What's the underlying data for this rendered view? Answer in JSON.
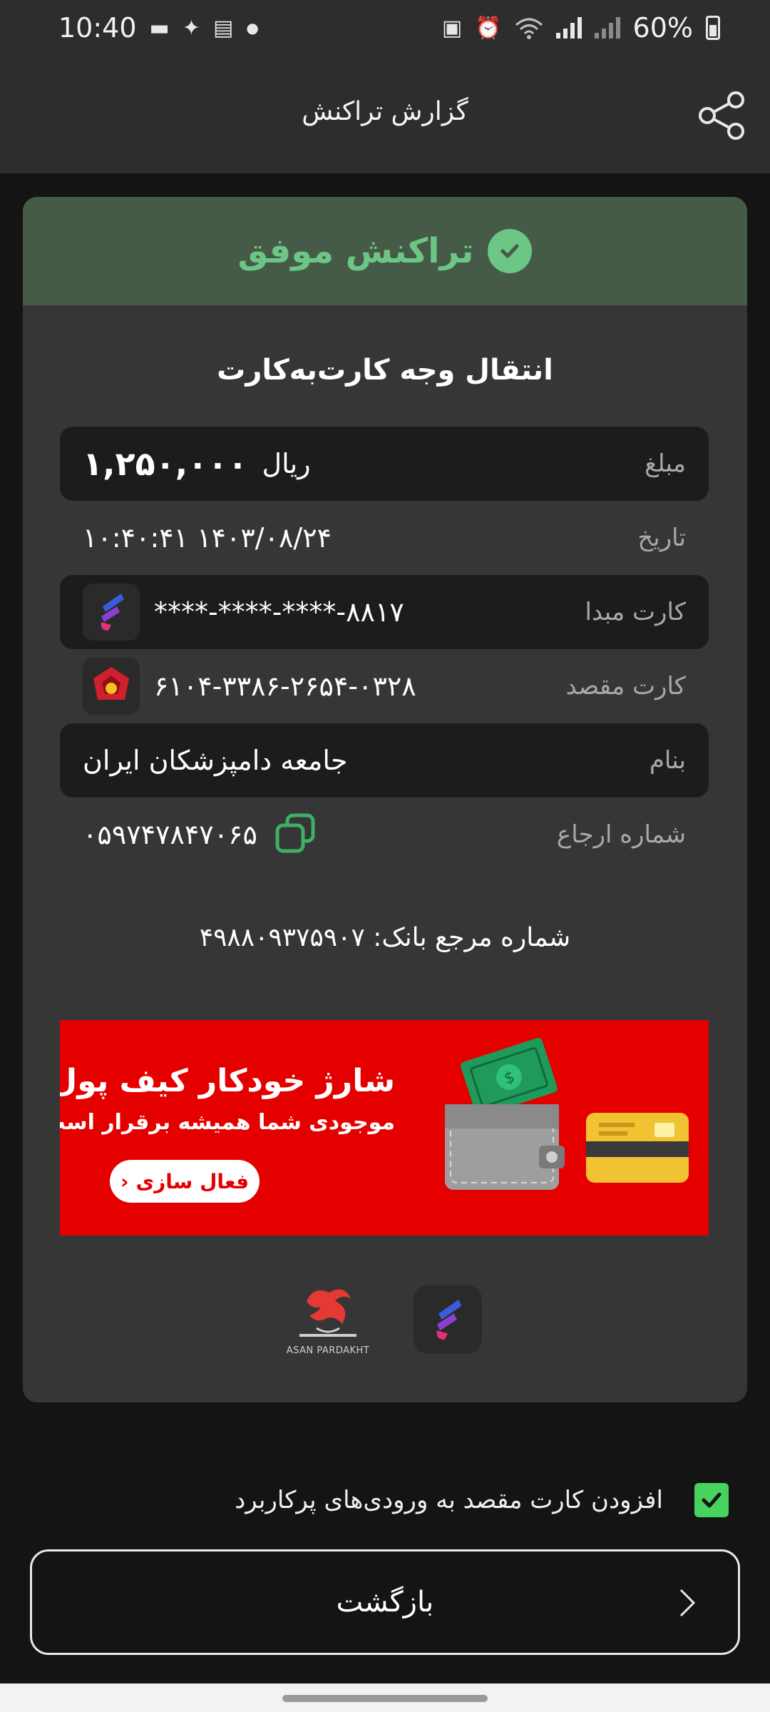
{
  "status_bar": {
    "time": "10:40",
    "battery": "60%",
    "icons": [
      "chat-icon",
      "bird-icon",
      "message-icon",
      "dot-icon",
      "battery-saver-icon",
      "alarm-icon",
      "wifi-icon",
      "signal-icon",
      "signal-icon-2",
      "battery-icon"
    ]
  },
  "header": {
    "title": "گزارش تراکنش",
    "share_icon": "share-icon"
  },
  "receipt": {
    "status": "تراکنش موفق",
    "status_color": "#6cc685",
    "type": "انتقال وجه کارت‌به‌کارت",
    "amount_label": "مبلغ",
    "amount_value": "۱,۲۵۰,۰۰۰",
    "amount_unit": "ریال",
    "date_label": "تاریخ",
    "date_value": "۱۰:۴۰:۴۱ ۱۴۰۳/۰۸/۲۴",
    "source_label": "کارت مبدا",
    "source_value": "****-****-****-۸۸۱۷",
    "dest_label": "کارت مقصد",
    "dest_value": "۶۱۰۴-۳۳۸۶-۲۶۵۴-۰۳۲۸",
    "name_label": "بنام",
    "name_value": "جامعه دامپزشکان ایران",
    "ref_label": "شماره ارجاع",
    "ref_value": "۰۵۹۷۴۷۸۴۷۰۶۵",
    "bank_ref": "شماره مرجع بانک: ۴۹۸۸۰۹۳۷۵۹۰۷"
  },
  "ad": {
    "title": "شارژ خودکار کیف پول",
    "subtitle": "موجودی شما همیشه برقرار است",
    "button": "فعال سازی",
    "bg_color": "#e50000"
  },
  "partners": {
    "asan_caption": "ASAN PARDAKHT"
  },
  "footer": {
    "save_card_label": "افزودن کارت مقصد به ورودی‌های پرکاربرد",
    "save_checked": true,
    "back_label": "بازگشت"
  }
}
